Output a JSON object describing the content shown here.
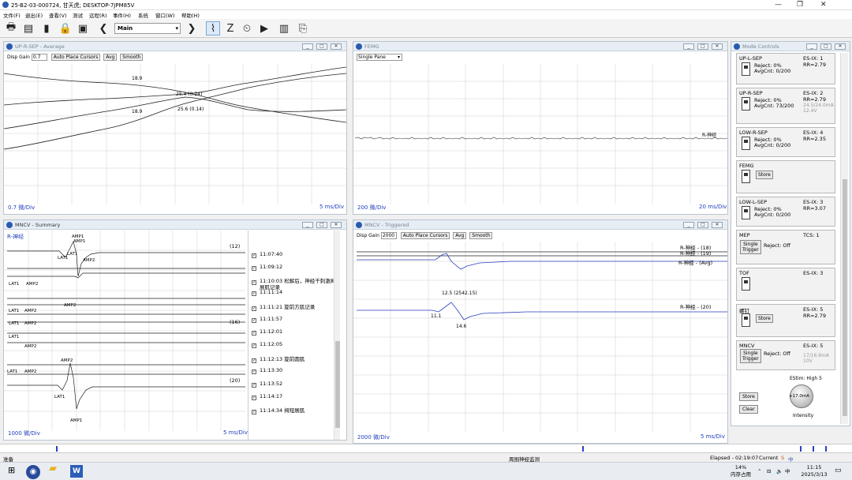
{
  "window": {
    "title": "25-B2-03-000724, 甘天虎; DESKTOP-7JPM85V"
  },
  "menu": [
    "文件(F)",
    "退出(E)",
    "查看(V)",
    "测试",
    "远程(R)",
    "事件(H)",
    "系统",
    "窗口(W)",
    "帮助(H)"
  ],
  "toolbar": {
    "mode": "Main"
  },
  "common": {
    "disp_gain": "Disp Gain",
    "auto_place": "Auto Place Cursors",
    "avg": "Avg",
    "smooth": "Smooth"
  },
  "up_sep": {
    "title": "UP-R-SEP - Average",
    "gain": "0.7",
    "scale_left": "0.7 微/Div",
    "scale_right": "5 ms/Div",
    "labels": [
      "18.9",
      "25.4 (0.24)",
      "18.9",
      "25.6 (0.14)"
    ]
  },
  "femg": {
    "title": "FEMG",
    "pane": "Single Pane",
    "trace_label": "R-神经",
    "scale_left": "200 微/Div",
    "scale_right": "20 ms/Div"
  },
  "mncv_sum": {
    "title": "MNCV - Summary",
    "trace_name": "R-神经",
    "scale_left": "1000 微/Div",
    "scale_right": "5 ms/Div",
    "counts": [
      "(12)",
      "(16)",
      "(20)"
    ],
    "markers": [
      "AMP1",
      "AMP1",
      "LAT1",
      "LAT1",
      "AMP2",
      "AMP2",
      "LAT1",
      "AMP2",
      "LAT1",
      "AMP2",
      "LAT1",
      "AMP2",
      "LAT1",
      "AMP2",
      "LAT1",
      "AMP2",
      "AMP2",
      "LAT1",
      "AMP1"
    ],
    "events": [
      {
        "time": "11:07:40",
        "note": ""
      },
      {
        "time": "11:09:12",
        "note": ""
      },
      {
        "time": "11:10:03",
        "note": "松解后，神经干刺激拇"
      },
      {
        "time": "",
        "note": "展肌记录"
      },
      {
        "time": "11:11:14",
        "note": ""
      },
      {
        "time": "11:11:21",
        "note": "旋前方肌记录"
      },
      {
        "time": "11:11:57",
        "note": ""
      },
      {
        "time": "11:12:01",
        "note": ""
      },
      {
        "time": "11:12:05",
        "note": ""
      },
      {
        "time": "11:12:13",
        "note": "旋前圆肌"
      },
      {
        "time": "11:13:30",
        "note": ""
      },
      {
        "time": "11:13:52",
        "note": ""
      },
      {
        "time": "11:14:17",
        "note": ""
      },
      {
        "time": "11:14:34",
        "note": "拇短展肌"
      }
    ]
  },
  "mncv_trig": {
    "title": "MNCV - Triggered",
    "gain": "2000",
    "trace_labels": [
      "R-神经 - (18)",
      "R-神经 - (19)",
      "R-神经 - (Avg)",
      "R-神经 - (20)"
    ],
    "labels": [
      "12.5 (2542.15)",
      "11.1",
      "14.6"
    ],
    "scale_left": "2000 微/Div",
    "scale_right": "5 ms/Div"
  },
  "mode_controls": {
    "title": "Mode Controls",
    "items": [
      {
        "name": "UP-L-SEP",
        "es": "ES-IX: 1",
        "rr": "RR=2.79",
        "reject": "Reject: 0%",
        "avg": "AvgCnt: 0/200",
        "dim": ""
      },
      {
        "name": "UP-R-SEP",
        "es": "ES-IX: 2",
        "rr": "RR=2.79",
        "reject": "Reject: 0%",
        "avg": "AvgCnt: 73/200",
        "dim": "24.5/24.0mA 12.4V"
      },
      {
        "name": "LOW-R-SEP",
        "es": "ES-IX: 4",
        "rr": "RR=2.35",
        "reject": "Reject: 0%",
        "avg": "AvgCnt: 0/200",
        "dim": ""
      },
      {
        "name": "FEMG",
        "es": "",
        "rr": "",
        "reject": "",
        "avg": "",
        "dim": ""
      },
      {
        "name": "LOW-L-SEP",
        "es": "ES-IX: 3",
        "rr": "RR=3.07",
        "reject": "Reject: 0%",
        "avg": "AvgCnt: 0/200",
        "dim": ""
      },
      {
        "name": "MEP",
        "es": "TCS: 1",
        "rr": "",
        "reject": "Reject: Off",
        "avg": "",
        "dim": ""
      },
      {
        "name": "TOF",
        "es": "ES-IX: 3",
        "rr": "",
        "reject": "",
        "avg": "",
        "dim": ""
      },
      {
        "name": "螺钉",
        "es": "ES-IX: 5",
        "rr": "RR=2.79",
        "reject": "",
        "avg": "",
        "dim": ""
      },
      {
        "name": "MNCV",
        "es": "ES-IX: 5",
        "rr": "",
        "reject": "Reject: Off",
        "avg": "",
        "dim": "17/16.6mA 10V"
      }
    ],
    "store": "Store",
    "single": "Single",
    "trigger": "Trigger",
    "estim": "EStim: High 5",
    "knob": "+17.0mA",
    "intensity": "Intensity",
    "clear": "Clear"
  },
  "status": {
    "left": "准备",
    "mid": "周围神经监测",
    "elapsed": "Elapsed - 02:19:07",
    "current": "Current"
  },
  "taskbar": {
    "cpu": "14%",
    "cpu_label": "内存占用",
    "time": "11:15",
    "date": "2025/3/13",
    "lang": "中"
  }
}
